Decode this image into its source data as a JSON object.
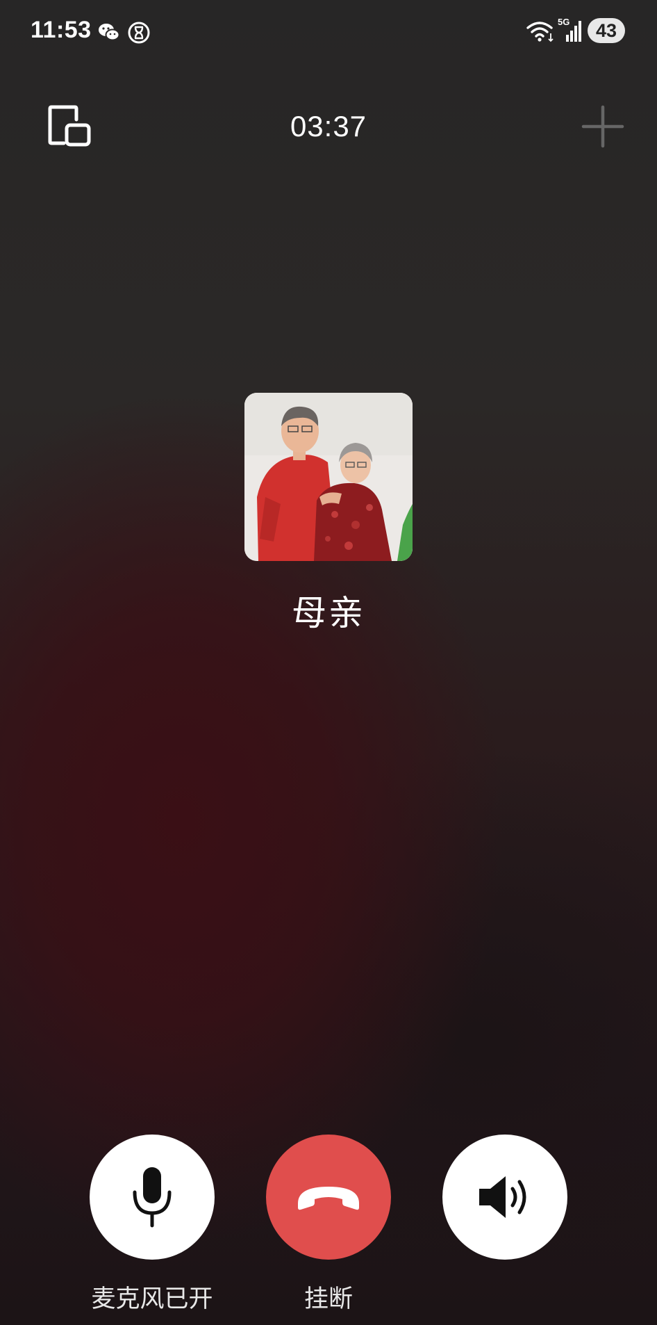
{
  "status_bar": {
    "time": "11:53",
    "network": "5G",
    "battery": "43",
    "icons": [
      "wechat-icon",
      "hourglass-icon",
      "wifi-icon",
      "signal-icon"
    ]
  },
  "call": {
    "timer": "03:37",
    "caller_name": "母亲"
  },
  "controls": {
    "mic_label": "麦克风已开",
    "hangup_label": "挂断",
    "speaker_label": ""
  },
  "colors": {
    "hangup": "#e04e4d",
    "button_bg": "#ffffff",
    "background_top": "#2a2828",
    "background_bottom": "#3a0f15"
  }
}
